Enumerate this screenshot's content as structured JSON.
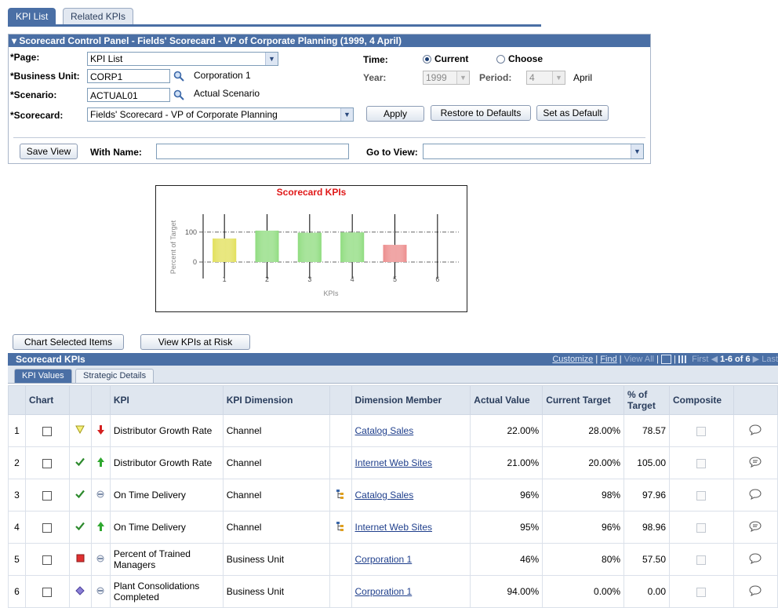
{
  "tabs": [
    {
      "label": "KPI List",
      "active": true
    },
    {
      "label": "Related KPIs",
      "active": false
    }
  ],
  "panel": {
    "title": "Scorecard Control Panel - Fields' Scorecard - VP of Corporate Planning (1999, 4 April)",
    "page_label": "*Page:",
    "page_value": "KPI List",
    "bu_label": "*Business Unit:",
    "bu_value": "CORP1",
    "bu_desc": "Corporation 1",
    "scenario_label": "*Scenario:",
    "scenario_value": "ACTUAL01",
    "scenario_desc": "Actual Scenario",
    "scorecard_label": "*Scorecard:",
    "scorecard_value": "Fields' Scorecard - VP of Corporate Planning",
    "time_label": "Time:",
    "time_current": "Current",
    "time_choose": "Choose",
    "year_label": "Year:",
    "year_value": "1999",
    "period_label": "Period:",
    "period_value": "4",
    "period_desc": "April",
    "apply": "Apply",
    "restore": "Restore to Defaults",
    "set_default": "Set as Default",
    "save_view": "Save View",
    "with_name_label": "With Name:",
    "with_name_value": "",
    "goto_label": "Go to View:",
    "goto_value": ""
  },
  "chart_data": {
    "type": "bar",
    "title": "Scorecard KPIs",
    "xlabel": "KPIs",
    "ylabel": "Percent of Target",
    "categories": [
      "1",
      "2",
      "3",
      "4",
      "5",
      "6"
    ],
    "values": [
      78.57,
      105.0,
      97.96,
      98.96,
      57.5,
      0.0
    ],
    "colors": [
      "#e2e05a",
      "#8fdc7f",
      "#8fdc7f",
      "#8fdc7f",
      "#ec8c8c",
      "#cccccc"
    ],
    "yticks": [
      0,
      100
    ],
    "ylim": [
      -55,
      160
    ]
  },
  "actions": {
    "chart_selected": "Chart Selected Items",
    "view_at_risk": "View KPIs at Risk"
  },
  "grid": {
    "title": "Scorecard KPIs",
    "nav": {
      "customize": "Customize",
      "find": "Find",
      "view_all": "View All",
      "first": "First",
      "range": "1-6 of 6",
      "last": "Last"
    },
    "subtabs": [
      {
        "label": "KPI Values",
        "active": true
      },
      {
        "label": "Strategic Details",
        "active": false
      }
    ],
    "columns": {
      "chart": "Chart",
      "kpi": "KPI",
      "dimension": "KPI Dimension",
      "member": "Dimension Member",
      "actual": "Actual Value",
      "target": "Current Target",
      "pct": "% of Target",
      "composite": "Composite"
    },
    "rows": [
      {
        "n": "1",
        "status": "triangle",
        "trend": "down",
        "kpi": "Distributor Growth Rate",
        "dimension": "Channel",
        "tree": false,
        "member": "Catalog Sales",
        "actual": "22.00%",
        "target": "28.00%",
        "pct": "78.57",
        "comment": "empty"
      },
      {
        "n": "2",
        "status": "check",
        "trend": "up",
        "kpi": "Distributor Growth Rate",
        "dimension": "Channel",
        "tree": false,
        "member": "Internet Web Sites",
        "actual": "21.00%",
        "target": "20.00%",
        "pct": "105.00",
        "comment": "filled"
      },
      {
        "n": "3",
        "status": "check",
        "trend": "flat",
        "kpi": "On Time Delivery",
        "dimension": "Channel",
        "tree": true,
        "member": "Catalog Sales",
        "actual": "96%",
        "target": "98%",
        "pct": "97.96",
        "comment": "empty"
      },
      {
        "n": "4",
        "status": "check",
        "trend": "up",
        "kpi": "On Time Delivery",
        "dimension": "Channel",
        "tree": true,
        "member": "Internet Web Sites",
        "actual": "95%",
        "target": "96%",
        "pct": "98.96",
        "comment": "filled"
      },
      {
        "n": "5",
        "status": "square",
        "trend": "flat",
        "kpi": "Percent of Trained Managers",
        "dimension": "Business Unit",
        "tree": false,
        "member": "Corporation 1",
        "actual": "46%",
        "target": "80%",
        "pct": "57.50",
        "comment": "empty"
      },
      {
        "n": "6",
        "status": "diamond",
        "trend": "flat",
        "kpi": "Plant Consolidations Completed",
        "dimension": "Business Unit",
        "tree": false,
        "member": "Corporation 1",
        "actual": "94.00%",
        "target": "0.00%",
        "pct": "0.00",
        "comment": "empty"
      }
    ]
  }
}
